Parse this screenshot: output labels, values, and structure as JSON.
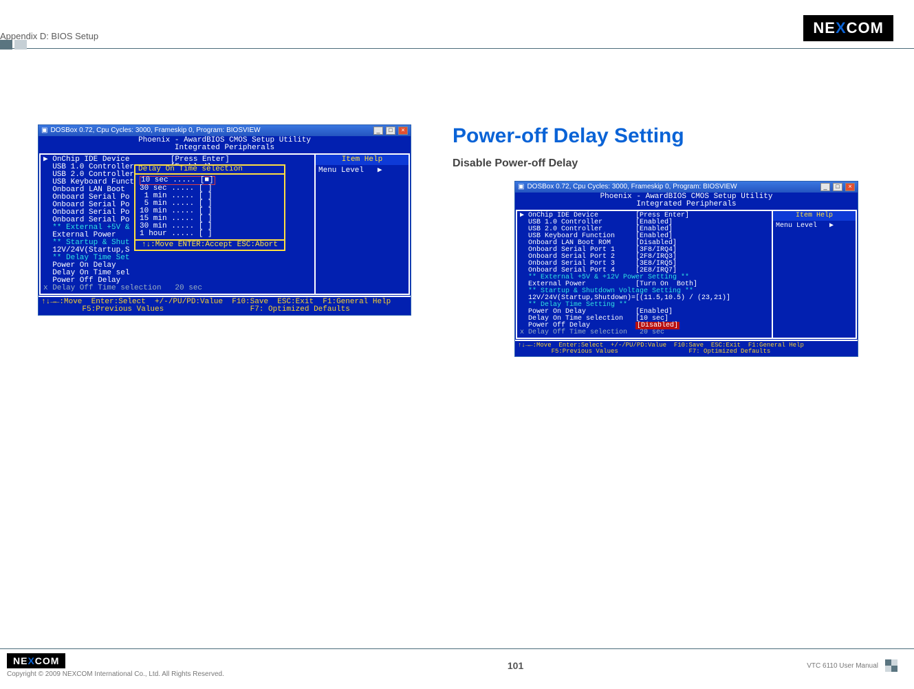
{
  "header": {
    "appendix_label": "Appendix D: BIOS Setup",
    "brand": "NEXCOM"
  },
  "left_shot": {
    "dosbox_title": "DOSBox 0.72, Cpu Cycles:    3000, Frameskip  0, Program: BIOSVIEW",
    "bios_title_1": "Phoenix - AwardBIOS CMOS Setup Utility",
    "bios_title_2": "Integrated Peripherals",
    "rows": {
      "r1": "▶ OnChip IDE Device         [Press Enter]",
      "r2": "  USB 1.0 Controller        [Enabled]",
      "r3": "  USB 2.0 Controller        [Enabled]",
      "r4": "  USB Keyboard Function     [Enabled]",
      "r5": "  Onboard LAN Boot",
      "r6": "  Onboard Serial Po",
      "r7": "  Onboard Serial Po",
      "r8": "  Onboard Serial Po",
      "r9": "  Onboard Serial Po",
      "r10": "  ** External +5V &",
      "r11": "  External Power",
      "r12": "  ** Startup & Shut",
      "r13": "  12V/24V(Startup,S",
      "r14": "  ** Delay Time Set",
      "r15": "  Power On Delay",
      "r16": "  Delay On Time sel",
      "r17": "  Power Off Delay",
      "r18": "x Delay Off Time selection   20 sec"
    },
    "popup": {
      "title": "Delay On Time selection",
      "opts": {
        "o1": "10 sec ..... [■]",
        "o2": "30 sec ..... [ ]",
        "o3": " 1 min ..... [ ]",
        "o4": " 5 min ..... [ ]",
        "o5": "10 min ..... [ ]",
        "o6": "15 min ..... [ ]",
        "o7": "30 min ..... [ ]",
        "o8": "1 hour ..... [ ]"
      },
      "foot": "↑↓:Move ENTER:Accept ESC:Abort"
    },
    "help": {
      "header": "Item Help",
      "line": "Menu Level   ▶"
    },
    "footer_1": "↑↓→←:Move  Enter:Select  +/-/PU/PD:Value  F10:Save  ESC:Exit  F1:General Help",
    "footer_2": "         F5:Previous Values                   F7: Optimized Defaults"
  },
  "right_section": {
    "title": "Power-off Delay Setting",
    "subtitle": "Disable Power-off Delay"
  },
  "right_shot": {
    "dosbox_title": "DOSBox 0.72, Cpu Cycles:    3000, Frameskip  0, Program: BIOSVIEW",
    "bios_title_1": "Phoenix - AwardBIOS CMOS Setup Utility",
    "bios_title_2": "Integrated Peripherals",
    "rows": {
      "r1": "▶ OnChip IDE Device         [Press Enter]",
      "r2": "  USB 1.0 Controller        [Enabled]",
      "r3": "  USB 2.0 Controller        [Enabled]",
      "r4": "  USB Keyboard Function     [Enabled]",
      "r5": "  Onboard LAN Boot ROM      [Disabled]",
      "r6": "  Onboard Serial Port 1     [3F8/IRQ4]",
      "r7": "  Onboard Serial Port 2     [2F8/IRQ3]",
      "r8": "  Onboard Serial Port 3     [3E8/IRQ5]",
      "r9": "  Onboard Serial Port 4     [2E8/IRQ7]",
      "r10": "",
      "r11": "  ** External +5V & +12V Power Setting **",
      "r12": "  External Power            [Turn On  Both]",
      "r13": "  ** Startup & Shutdown Voltage Setting **",
      "r14": "  12V/24V(Startup,Shutdown)=[(11.5,10.5) / (23,21)]",
      "r15": "  ** Delay Time Setting **",
      "r16": "  Power On Delay            [Enabled]",
      "r17": "  Delay On Time selection   [10 sec]",
      "r18a": "  Power Off Delay           ",
      "r18b": "[Disabled]",
      "r19": "x Delay Off Time selection   20 sec"
    },
    "help": {
      "header": "Item Help",
      "line": "Menu Level   ▶"
    },
    "footer_1": "↑↓→←:Move  Enter:Select  +/-/PU/PD:Value  F10:Save  ESC:Exit  F1:General Help",
    "footer_2": "         F5:Previous Values                   F7: Optimized Defaults"
  },
  "footer": {
    "brand": "NEXCOM",
    "copyright": "Copyright © 2009 NEXCOM International Co., Ltd. All Rights Reserved.",
    "page": "101",
    "manual": "VTC 6110 User Manual"
  }
}
